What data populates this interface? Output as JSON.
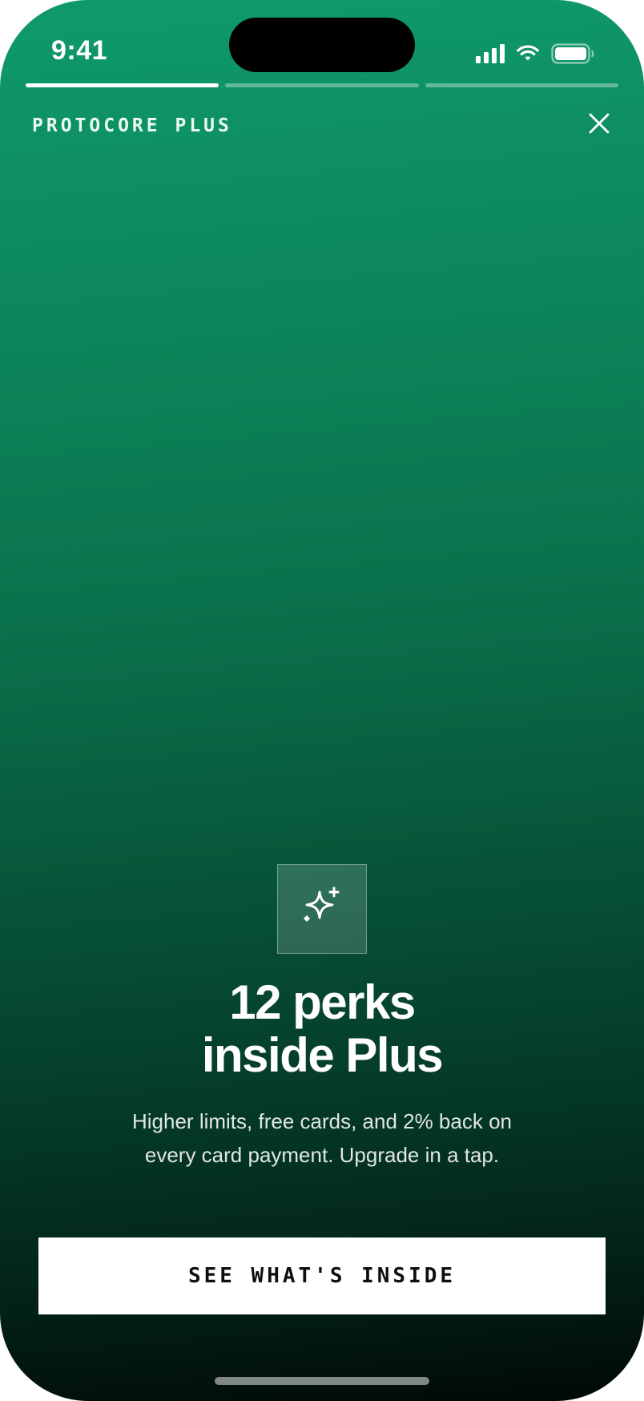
{
  "status_bar": {
    "time": "9:41"
  },
  "story_progress": {
    "segments": [
      {
        "fill_fraction": 1.0
      },
      {
        "fill_fraction": 0.0
      },
      {
        "fill_fraction": 0.0
      }
    ]
  },
  "header": {
    "brand": "PROTOCORE PLUS",
    "close_icon": "close-icon"
  },
  "content": {
    "icon": "sparkle-icon",
    "headline_line1": "12 perks",
    "headline_line2": "inside Plus",
    "description": "Higher limits, free cards, and 2% back on every card payment. Upgrade in a tap."
  },
  "cta": {
    "label": "SEE WHAT'S INSIDE"
  },
  "colors": {
    "gradient_top": "#0f9a6a",
    "gradient_bottom": "#010806",
    "button_bg": "#ffffff",
    "button_text": "#0b0f0d"
  }
}
